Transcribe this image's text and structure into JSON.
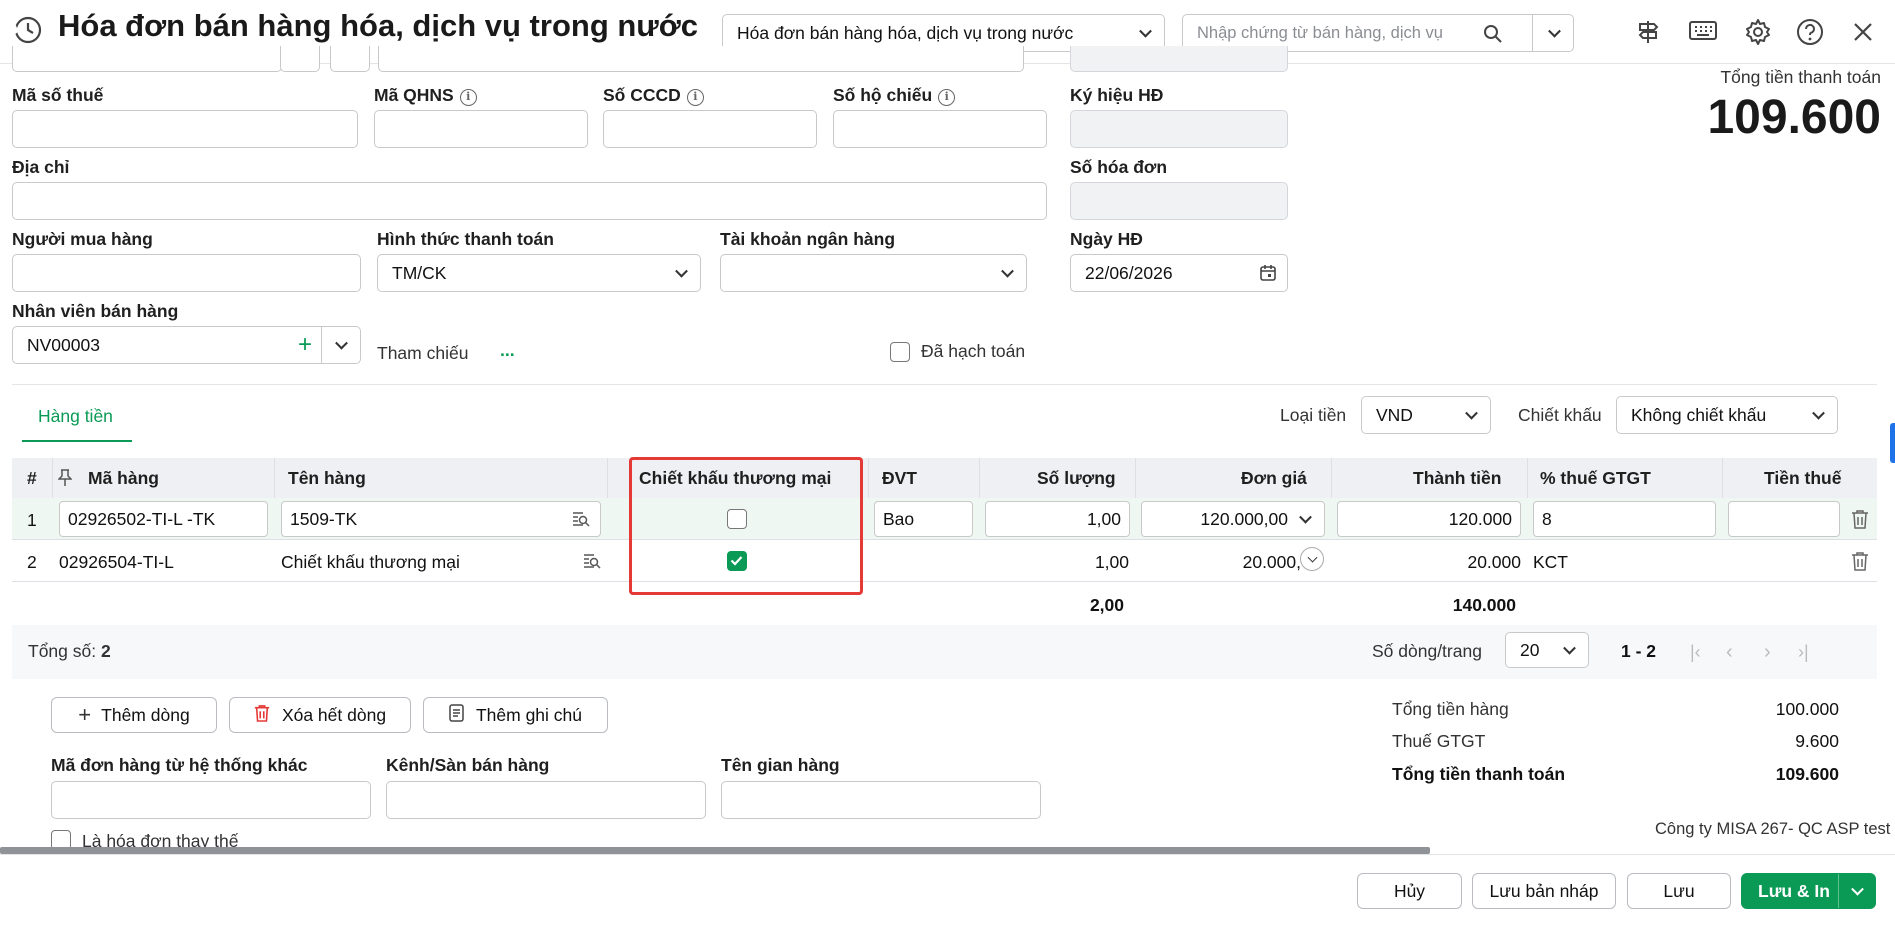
{
  "header": {
    "title": "Hóa đơn bán hàng hóa, dịch vụ trong nước",
    "type_select": "Hóa đơn bán hàng hóa, dịch vụ trong nước",
    "search_placeholder": "Nhập chứng từ bán hàng, dịch vụ"
  },
  "total_box": {
    "label": "Tổng tiền thanh toán",
    "value": "109.600"
  },
  "form": {
    "tax_code_label": "Mã số thuế",
    "qhns_label": "Mã QHNS",
    "cccd_label": "Số CCCD",
    "passport_label": "Số hộ chiếu",
    "symbol_label": "Ký hiệu HĐ",
    "address_label": "Địa chỉ",
    "invoice_no_label": "Số hóa đơn",
    "buyer_label": "Người mua hàng",
    "payment_label": "Hình thức thanh toán",
    "payment_value": "TM/CK",
    "bank_label": "Tài khoản ngân hàng",
    "date_label": "Ngày HĐ",
    "date_value": "22/06/2026",
    "staff_label": "Nhân viên bán hàng",
    "staff_value": "NV00003",
    "ref_label": "Tham chiếu",
    "ref_more": "...",
    "posted_label": "Đã hạch toán"
  },
  "tabs": {
    "goods": "Hàng tiền"
  },
  "currency": {
    "label": "Loại tiền",
    "value": "VND"
  },
  "discount": {
    "label": "Chiết khấu",
    "value": "Không chiết khấu"
  },
  "table": {
    "headers": {
      "num": "#",
      "code": "Mã hàng",
      "name": "Tên hàng",
      "trade_discount": "Chiết khấu thương mại",
      "unit": "ĐVT",
      "qty": "Số lượng",
      "price": "Đơn giá",
      "amount": "Thành tiền",
      "vat": "% thuế GTGT",
      "tax": "Tiền thuế"
    },
    "rows": [
      {
        "num": "1",
        "code": "02926502-TI-L -TK",
        "name": "1509-TK",
        "discount": false,
        "unit": "Bao",
        "qty": "1,00",
        "price": "120.000,00",
        "amount": "120.000",
        "vat": "8"
      },
      {
        "num": "2",
        "code": "02926504-TI-L",
        "name": "Chiết khấu thương mại",
        "discount": true,
        "unit": "",
        "qty": "1,00",
        "price": "20.000,",
        "amount": "20.000",
        "vat": "KCT"
      }
    ],
    "totals": {
      "qty": "2,00",
      "amount": "140.000"
    }
  },
  "pagination": {
    "count_label": "Tổng số:",
    "count_value": "2",
    "rows_per_page_label": "Số dòng/trang",
    "rows_per_page": "20",
    "range": "1 - 2"
  },
  "actions": {
    "add_row": "Thêm dòng",
    "clear_rows": "Xóa hết dòng",
    "add_note": "Thêm ghi chú"
  },
  "extra": {
    "order_code_label": "Mã đơn hàng từ hệ thống khác",
    "channel_label": "Kênh/Sàn bán hàng",
    "store_label": "Tên gian hàng",
    "replace_label": "Là hóa đơn thay thế"
  },
  "summary": {
    "goods_label": "Tổng tiền hàng",
    "goods_value": "100.000",
    "vat_label": "Thuế GTGT",
    "vat_value": "9.600",
    "total_label": "Tổng tiền thanh toán",
    "total_value": "109.600"
  },
  "company": "Công ty MISA 267- QC ASP test",
  "footer": {
    "cancel": "Hủy",
    "save_draft": "Lưu bản nháp",
    "save": "Lưu",
    "save_print": "Lưu & In"
  },
  "colors": {
    "accent": "#0a9a55",
    "highlight": "#e53935"
  }
}
